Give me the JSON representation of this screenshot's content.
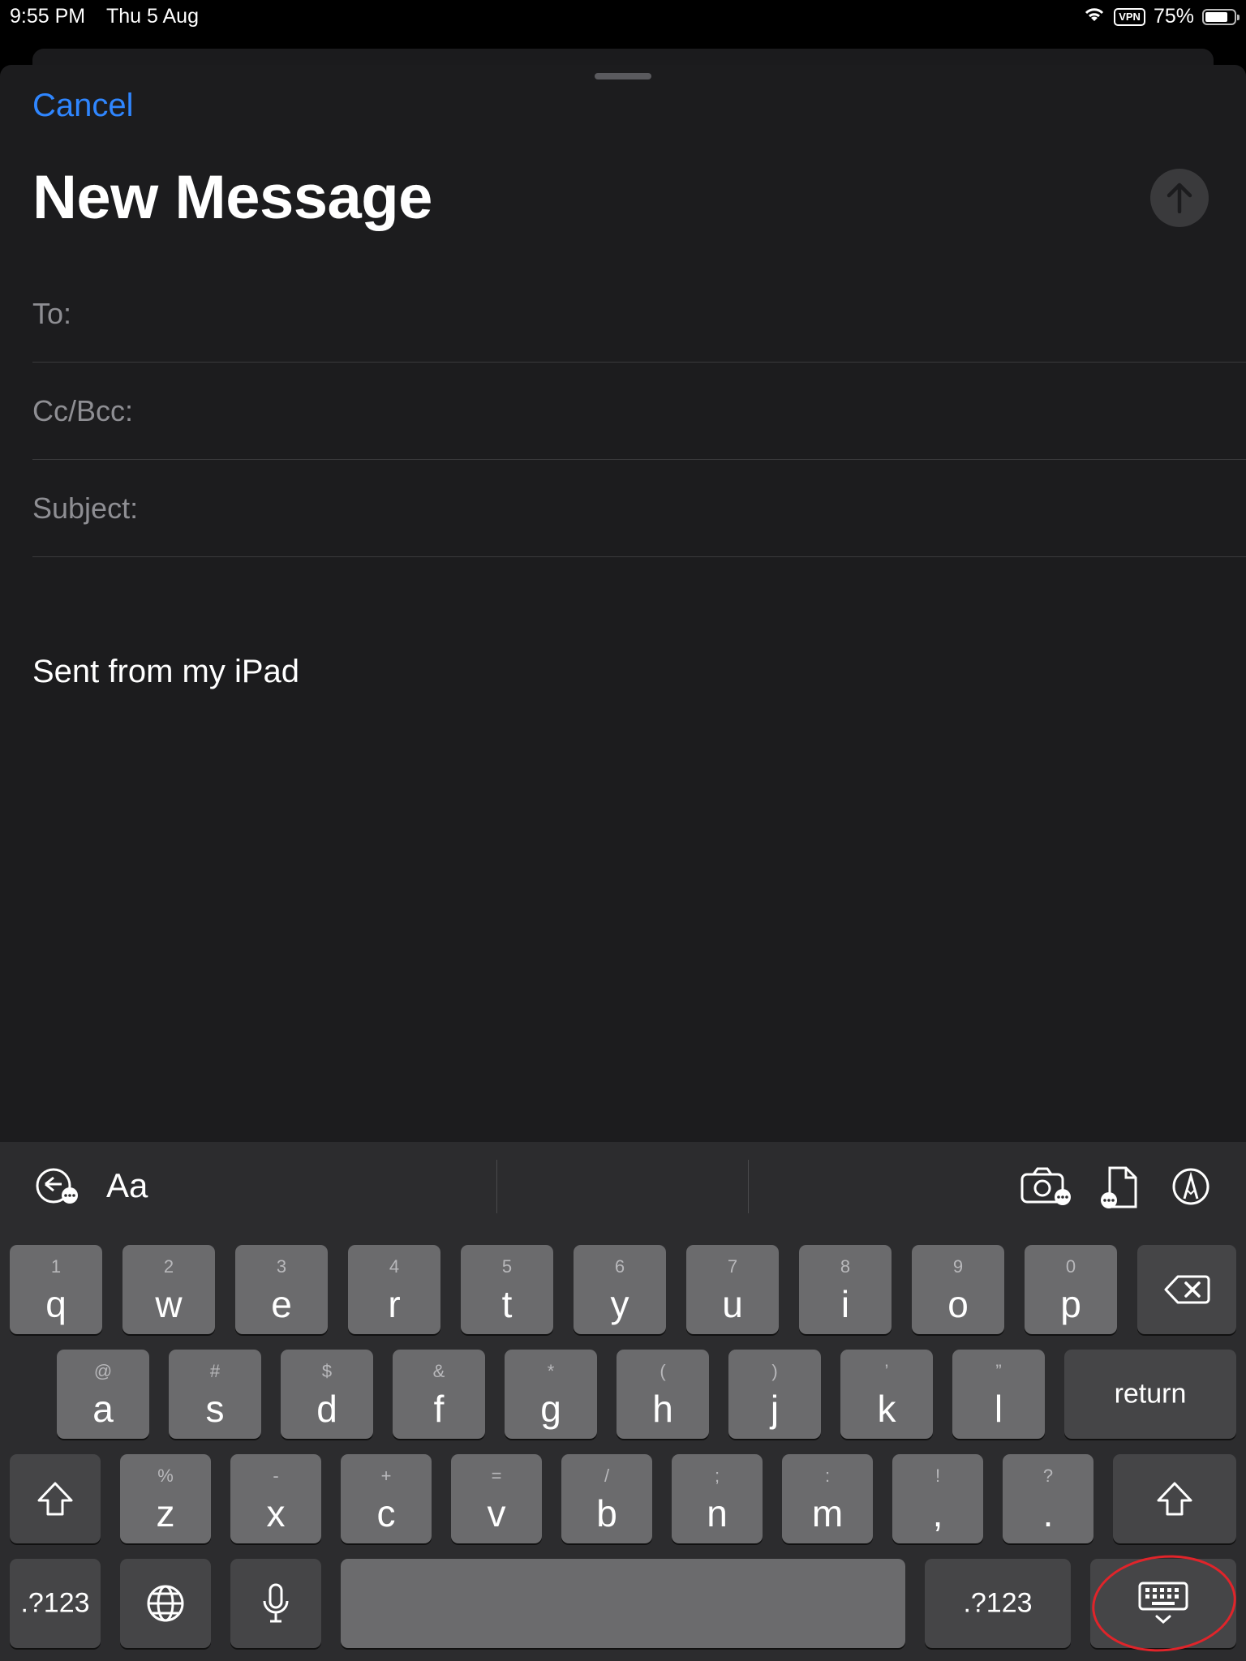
{
  "status_bar": {
    "time": "9:55 PM",
    "date": "Thu 5 Aug",
    "vpn": "VPN",
    "battery": "75%"
  },
  "compose": {
    "cancel_label": "Cancel",
    "title": "New Message",
    "to_label": "To:",
    "cc_label": "Cc/Bcc:",
    "subject_label": "Subject:",
    "signature": "Sent from my iPad"
  },
  "keyboard_toolbar": {
    "format_label": "Aa"
  },
  "keyboard": {
    "row1": [
      {
        "hint": "1",
        "key": "q"
      },
      {
        "hint": "2",
        "key": "w"
      },
      {
        "hint": "3",
        "key": "e"
      },
      {
        "hint": "4",
        "key": "r"
      },
      {
        "hint": "5",
        "key": "t"
      },
      {
        "hint": "6",
        "key": "y"
      },
      {
        "hint": "7",
        "key": "u"
      },
      {
        "hint": "8",
        "key": "i"
      },
      {
        "hint": "9",
        "key": "o"
      },
      {
        "hint": "0",
        "key": "p"
      }
    ],
    "row2": [
      {
        "hint": "@",
        "key": "a"
      },
      {
        "hint": "#",
        "key": "s"
      },
      {
        "hint": "$",
        "key": "d"
      },
      {
        "hint": "&",
        "key": "f"
      },
      {
        "hint": "*",
        "key": "g"
      },
      {
        "hint": "(",
        "key": "h"
      },
      {
        "hint": ")",
        "key": "j"
      },
      {
        "hint": "’",
        "key": "k"
      },
      {
        "hint": "”",
        "key": "l"
      }
    ],
    "row3": [
      {
        "hint": "%",
        "key": "z"
      },
      {
        "hint": "-",
        "key": "x"
      },
      {
        "hint": "+",
        "key": "c"
      },
      {
        "hint": "=",
        "key": "v"
      },
      {
        "hint": "/",
        "key": "b"
      },
      {
        "hint": ";",
        "key": "n"
      },
      {
        "hint": ":",
        "key": "m"
      },
      {
        "hint": "!",
        "key": ","
      },
      {
        "hint": "?",
        "key": "."
      }
    ],
    "return_label": "return",
    "numbers_label": ".?123"
  },
  "colors": {
    "accent": "#2f86ff",
    "annotation": "#e0242a"
  }
}
